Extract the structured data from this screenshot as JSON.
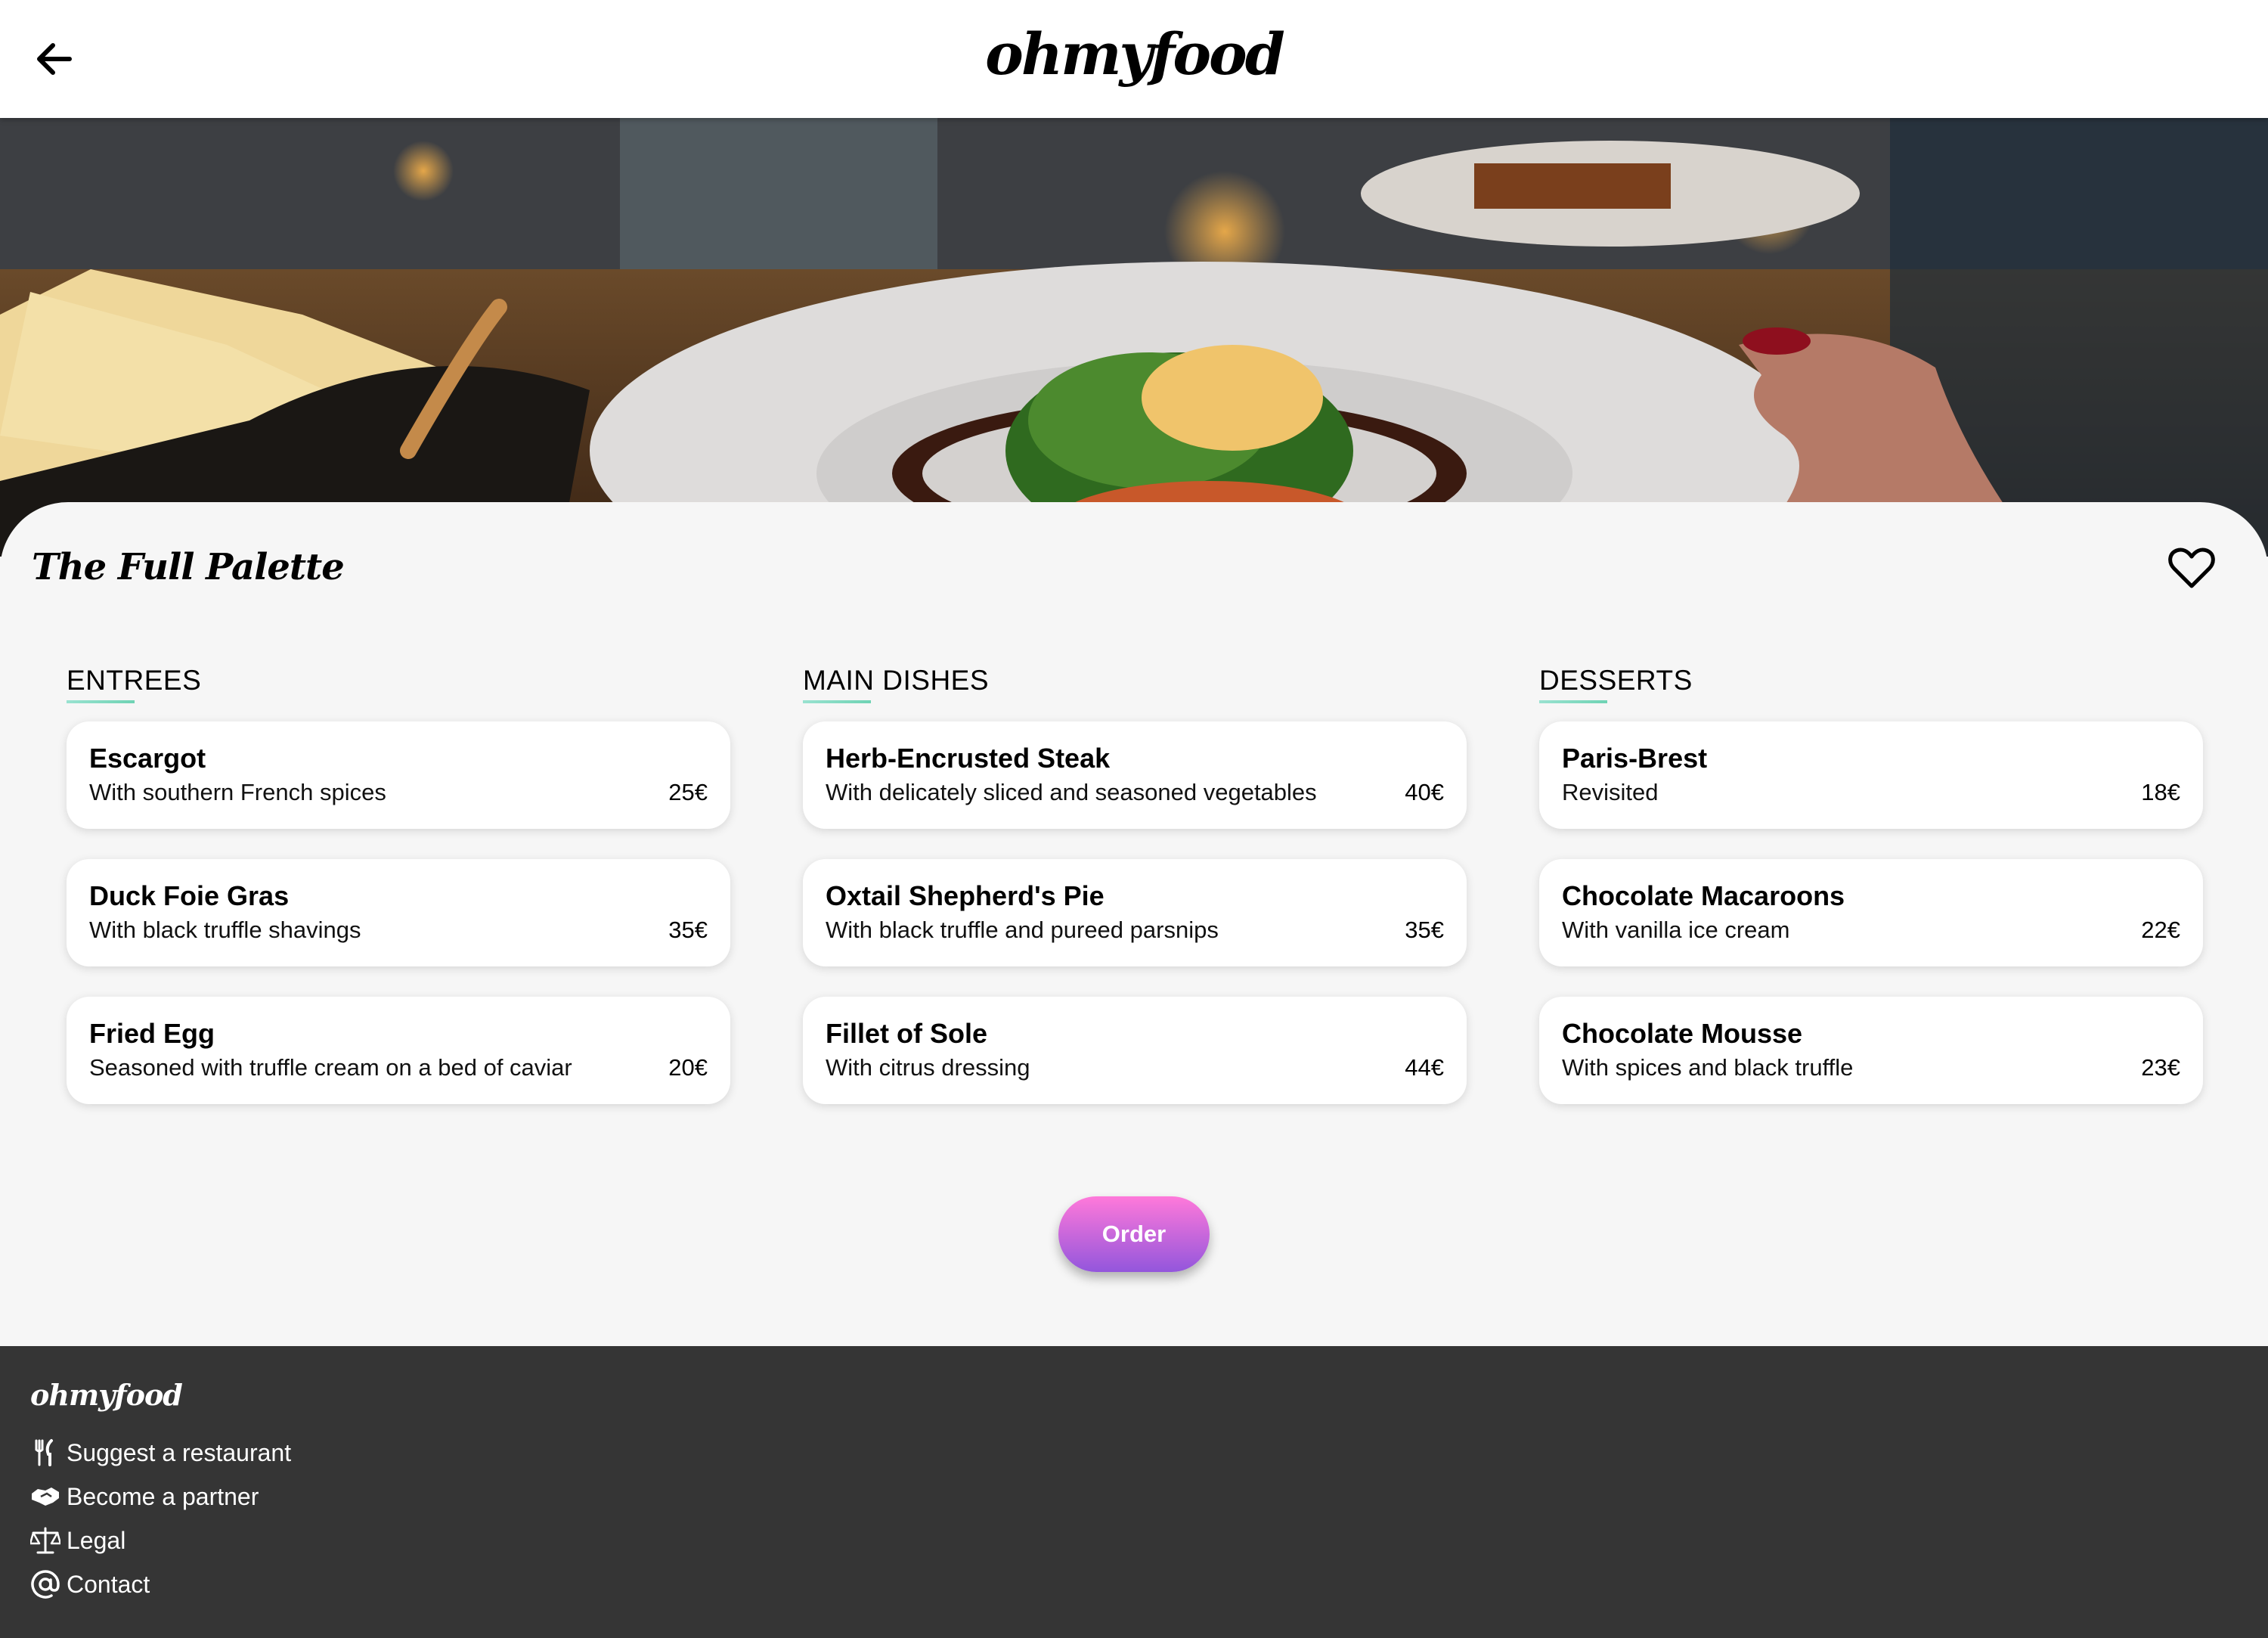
{
  "header": {
    "brand": "ohmyfood",
    "back_icon": "arrow-left-icon"
  },
  "restaurant": {
    "name": "The Full Palette",
    "favorite_icon": "heart-outline-icon"
  },
  "menu": [
    {
      "title": "ENTREES",
      "dishes": [
        {
          "name": "Escargot",
          "description": "With southern French spices",
          "price": "25€"
        },
        {
          "name": "Duck Foie Gras",
          "description": "With black truffle shavings",
          "price": "35€"
        },
        {
          "name": "Fried Egg",
          "description": "Seasoned with truffle cream on a bed of caviar",
          "price": "20€"
        }
      ]
    },
    {
      "title": "MAIN DISHES",
      "dishes": [
        {
          "name": "Herb-Encrusted Steak",
          "description": "With delicately sliced and seasoned vegetables",
          "price": "40€"
        },
        {
          "name": "Oxtail Shepherd's Pie",
          "description": "With black truffle and pureed parsnips",
          "price": "35€"
        },
        {
          "name": "Fillet of Sole",
          "description": "With citrus dressing",
          "price": "44€"
        }
      ]
    },
    {
      "title": "DESSERTS",
      "dishes": [
        {
          "name": "Paris-Brest",
          "description": "Revisited",
          "price": "18€"
        },
        {
          "name": "Chocolate Macaroons",
          "description": "With vanilla ice cream",
          "price": "22€"
        },
        {
          "name": "Chocolate Mousse",
          "description": "With spices and black truffle",
          "price": "23€"
        }
      ]
    }
  ],
  "order_label": "Order",
  "footer": {
    "brand": "ohmyfood",
    "links": [
      {
        "label": "Suggest a restaurant",
        "icon": "utensils-icon"
      },
      {
        "label": "Become a partner",
        "icon": "handshake-icon"
      },
      {
        "label": "Legal",
        "icon": "scale-icon"
      },
      {
        "label": "Contact",
        "icon": "at-sign-icon"
      }
    ]
  },
  "colors": {
    "accent_gradient_start": "#ff79da",
    "accent_gradient_end": "#9356dc",
    "section_underline": "#99e2d0",
    "footer_bg": "#353535",
    "page_bg": "#f6f6f6"
  }
}
